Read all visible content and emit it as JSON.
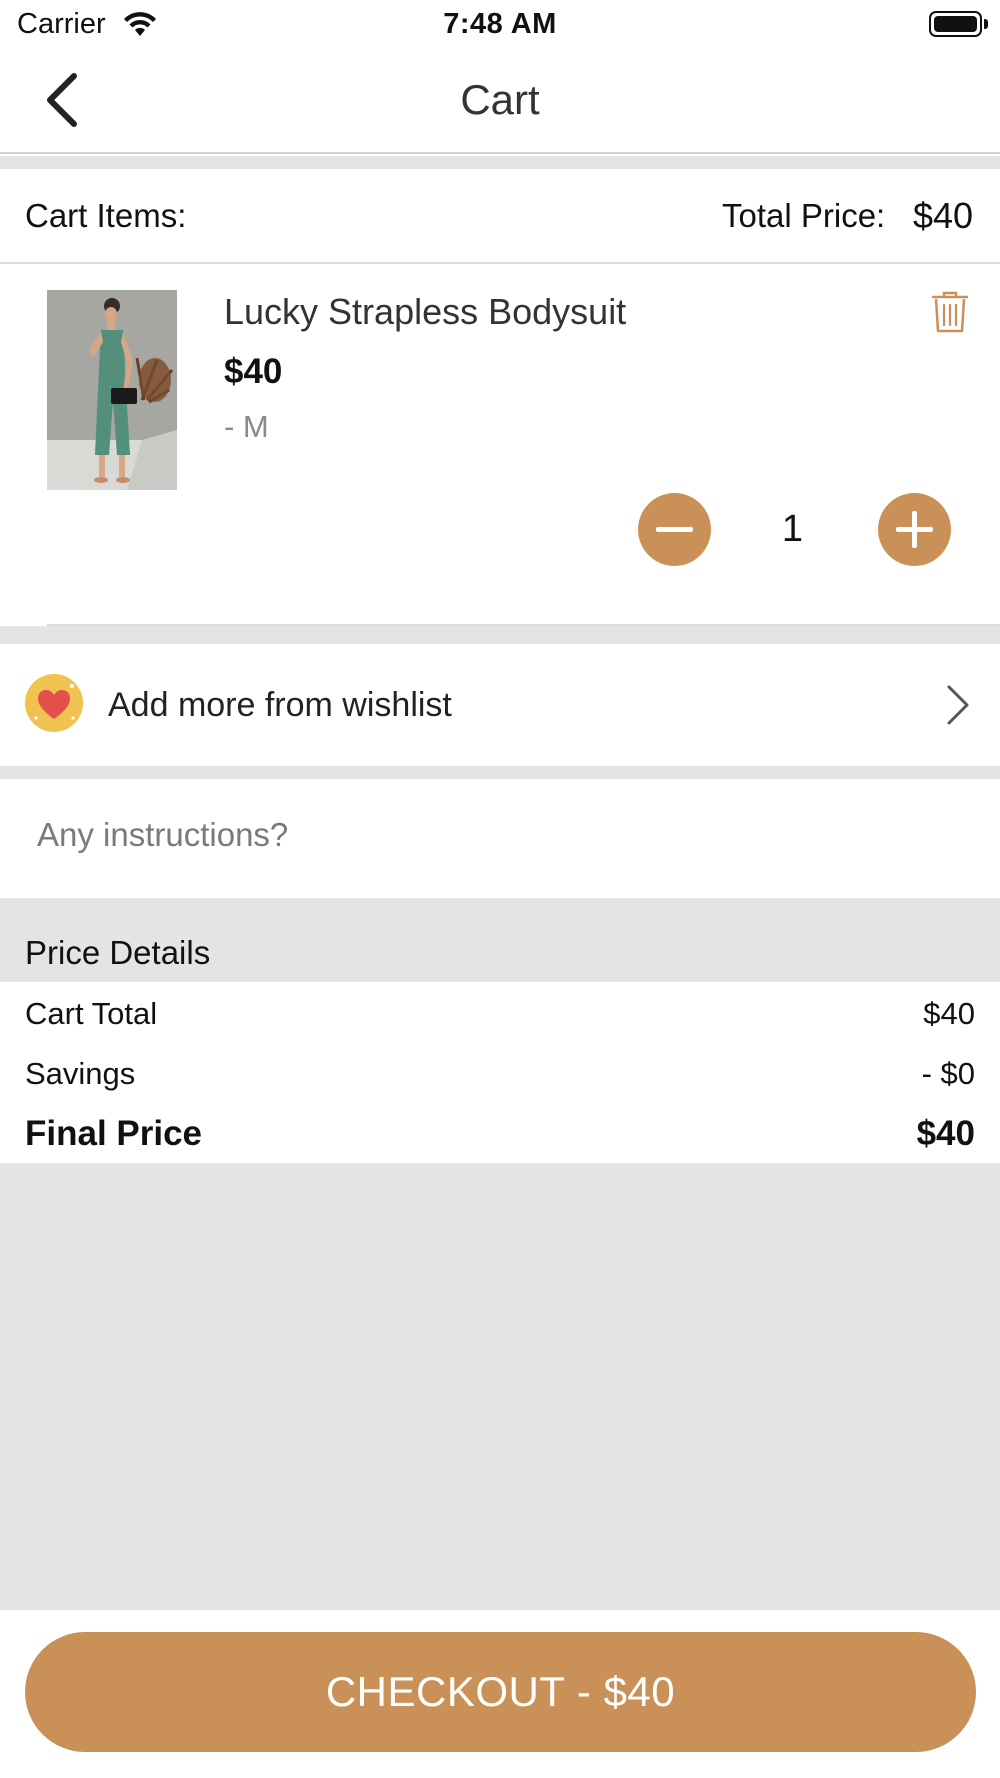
{
  "status_bar": {
    "carrier": "Carrier",
    "time": "7:48 AM",
    "icons": [
      "wifi-icon",
      "battery-icon"
    ]
  },
  "nav": {
    "title": "Cart",
    "back_icon": "chevron-left-icon"
  },
  "cart_header": {
    "items_label": "Cart Items:",
    "total_label": "Total Price:",
    "total_value": "$40"
  },
  "cart_items": [
    {
      "name": "Lucky Strapless Bodysuit",
      "price": "$40",
      "variant": "- M",
      "quantity": "1",
      "image_icon": "product-photo",
      "delete_icon": "trash-icon"
    }
  ],
  "wishlist": {
    "label": "Add more from wishlist",
    "icon": "heart-icon",
    "chevron_icon": "chevron-right-icon"
  },
  "instructions": {
    "placeholder": "Any instructions?"
  },
  "price_details": {
    "title": "Price Details",
    "rows": [
      {
        "label": "Cart Total",
        "value": "$40"
      },
      {
        "label": "Savings",
        "value": "- $0"
      }
    ],
    "final_label": "Final Price",
    "final_value": "$40"
  },
  "checkout": {
    "label": "CHECKOUT - $40"
  },
  "colors": {
    "accent": "#c99157",
    "section_gray": "#e4e4e4",
    "wish_badge": "#f0c24f",
    "heart": "#e2504a"
  }
}
